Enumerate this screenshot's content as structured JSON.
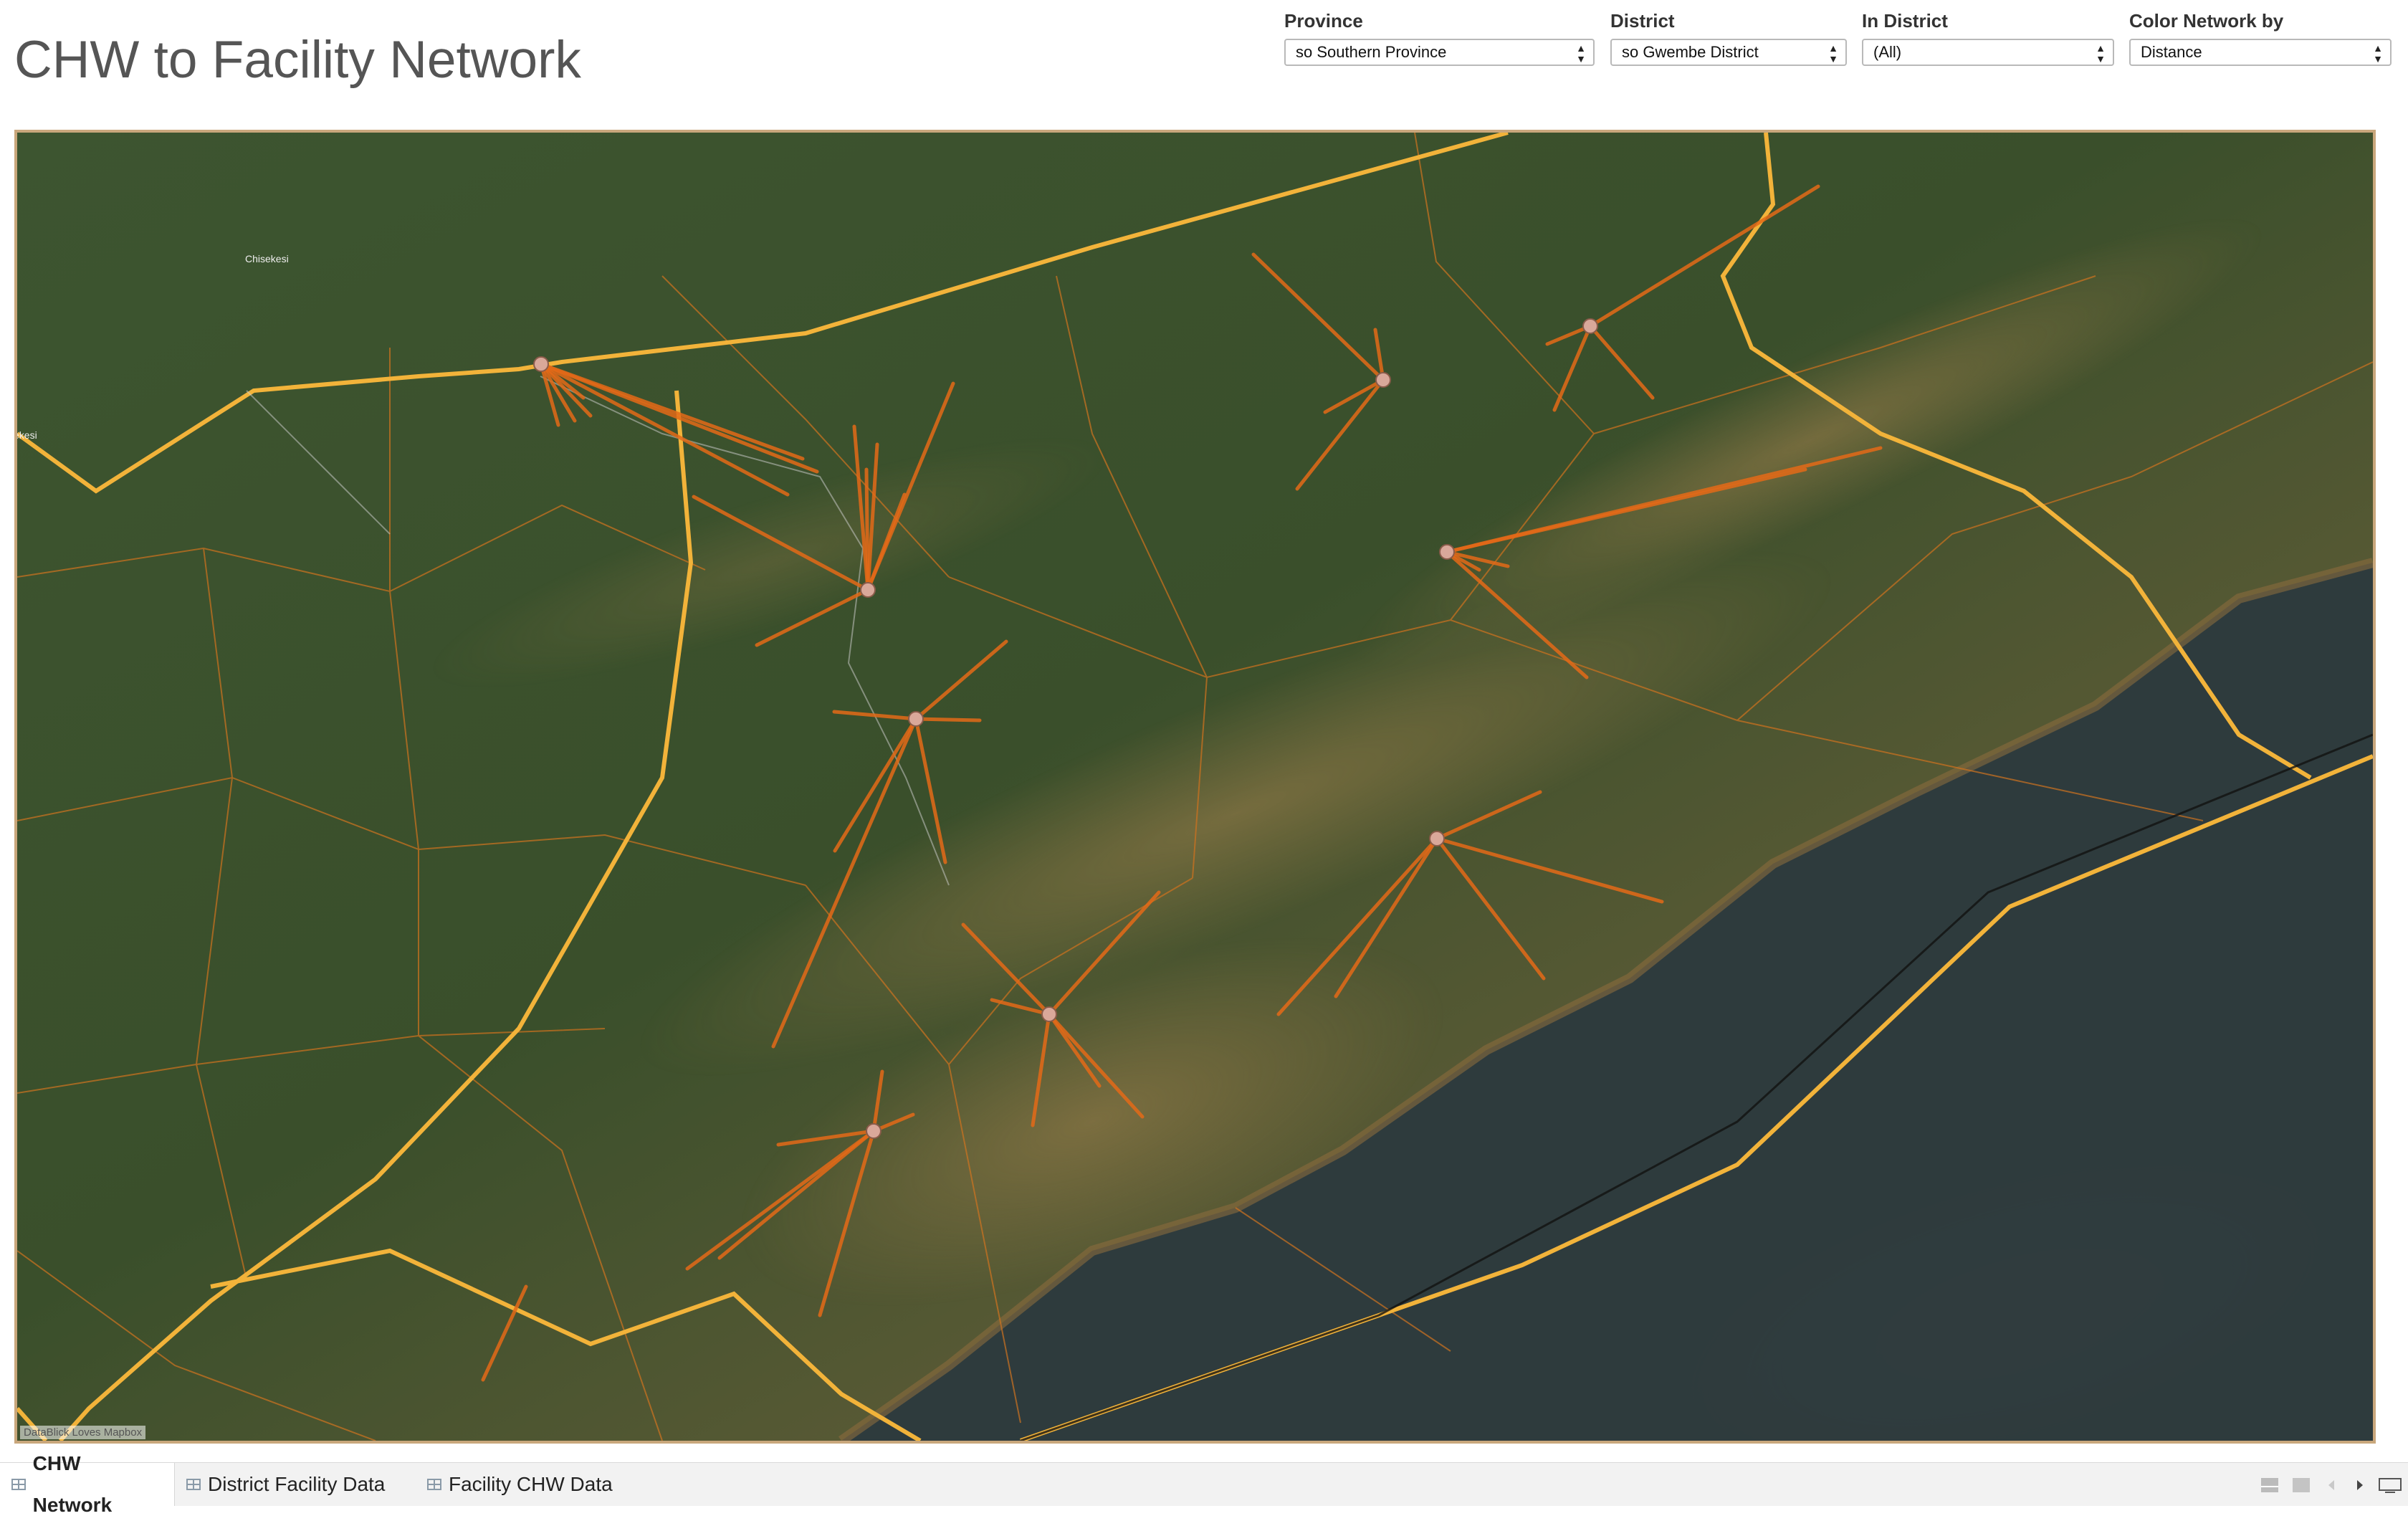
{
  "page": {
    "title": "CHW to Facility Network"
  },
  "filters": [
    {
      "label": "Province",
      "value": "so Southern Province"
    },
    {
      "label": "District",
      "value": "so Gwembe District"
    },
    {
      "label": "In District",
      "value": "(All)"
    },
    {
      "label": "Color Network by",
      "value": "Distance"
    }
  ],
  "map": {
    "place_labels": [
      "Chisekesi",
      "ekesi"
    ],
    "attribution": "DataBlick Loves Mapbox",
    "colors": {
      "boundary": "#f2b33a",
      "network_line": "#e46a17",
      "facility_node": "#d9a89a"
    }
  },
  "tabs": [
    {
      "label": "CHW Network",
      "active": true,
      "icon": "sheet-icon"
    },
    {
      "label": "District Facility Data",
      "active": false,
      "icon": "sheet-icon"
    },
    {
      "label": "Facility CHW Data",
      "active": false,
      "icon": "sheet-icon"
    }
  ],
  "bottom_controls": [
    "layout-icon",
    "fit-icon",
    "prev-icon",
    "next-icon",
    "present-icon"
  ]
}
